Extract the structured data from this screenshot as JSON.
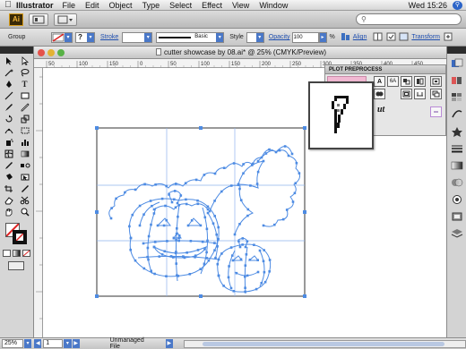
{
  "menubar": {
    "app_name": "Illustrator",
    "items": [
      "File",
      "Edit",
      "Object",
      "Type",
      "Select",
      "Effect",
      "View",
      "Window"
    ],
    "clock": "Wed 15:26"
  },
  "appbar": {
    "logo_text": "Ai",
    "search_placeholder": ""
  },
  "controlbar": {
    "selection_label": "Group",
    "stroke_label": "Stroke",
    "brush_label": "Basic",
    "style_label": "Style",
    "opacity_label": "Opacity",
    "opacity_value": "100",
    "percent": "%",
    "align_label": "Align",
    "transform_label": "Transform",
    "help_glyph": "?"
  },
  "document": {
    "title": "cutter showcase by 08.ai* @ 25% (CMYK/Preview)",
    "ruler_top_ticks": [
      "50",
      "100",
      "150",
      "0",
      "50",
      "100",
      "150",
      "200",
      "250",
      "300",
      "350",
      "400",
      "450"
    ]
  },
  "plot_panel": {
    "title": "PLOT PREPROCESS",
    "button_text": "6A",
    "script_glyph": "ut"
  },
  "status": {
    "zoom": "25%",
    "artboard": "1",
    "info": "Unmanaged File"
  },
  "colors": {
    "accent_blue": "#4a78c8",
    "path_blue": "#4d8be3",
    "pink_highlight": "#f2b9d3"
  }
}
